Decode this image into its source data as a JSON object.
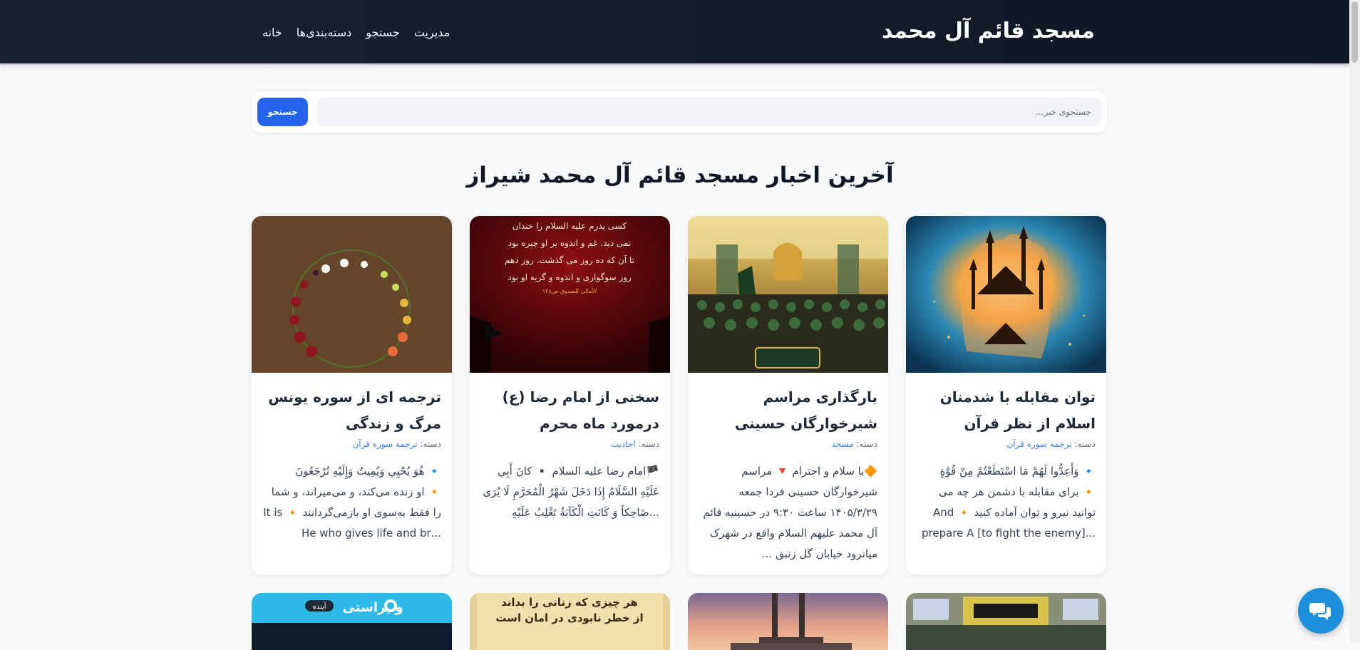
{
  "navbar": {
    "brand": "مسجد قائم آل محمد",
    "links": [
      "خانه",
      "دسته‌بندی‌ها",
      "جستجو",
      "مدیریت"
    ]
  },
  "search": {
    "placeholder": "جستجوی خبر...",
    "button_label": "جستجو"
  },
  "page_title": "آخرین اخبار مسجد قائم آل محمد شیراز",
  "category_prefix": "دسته:",
  "cards": [
    {
      "title": "توان مقابله با شدمنان اسلام از نظر قرآن",
      "category": "ترجمه سوره قرآن",
      "excerpt": [
        "🔹 وَأَعِدُّوا لَهُمْ مَا اسْتَطَعْتُمْ مِنْ قُوَّةٍ",
        "🔸 برای مقابله با دشمن هر چه می",
        "توانید نیرو و توان آماده کنید 🔸 And",
        "...[to fight the enemy] prepare A"
      ],
      "image": "fist-missiles-image"
    },
    {
      "title": "بارگذاری مراسم شیرخوارگان حسینی",
      "category": "مسجد",
      "excerpt": [
        "🔶با سلام و احترام 🔻 مراسم",
        "شیرخوارگان حسینی فردا جمعه",
        "۱۴۰۵/۳/۲۹ ساعت ۹:۳۰ در حسینیه قائم",
        "آل محمد علیهم السلام واقع در شهرک",
        "میانرود خیابان گل زنبق ..."
      ],
      "image": "ceremony-poster-image"
    },
    {
      "title": "سخنی از امام رضا (ع) درمورد ماه محرم",
      "category": "احادیث",
      "excerpt": [
        "🏴امام رضا علیه السلام ▪️ كانَ أَبِي",
        "عَلَيْهِ السَّلَامُ إِذَا دَخَلَ شَهْرُ الْمُحَرَّمِ لَا يُرَى",
        "...ضَاحِكاً وَ كَانَتِ الْكَآبَةُ تَغْلِبُ عَلَيْهِ"
      ],
      "image": "muharram-hadith-image",
      "image_text": [
        "کسی پدرم علیه السلام را خندان",
        "نمی دید. غم و اندوه بر او چیره بود",
        "تا آن که ده روز می گذشت. روز دهم",
        "روز سوگواری و اندوه و گریه او بود",
        "الأمالی للصدوق ص۱۲۸"
      ]
    },
    {
      "title": "ترجمه ای از سوره یونس مرگ و زندگی",
      "category": "ترجمه سوره قرآن",
      "excerpt": [
        "🔹 هُوَ يُحْيِي وَيُمِيتُ وَإِلَيْهِ تُرْجَعُونَ",
        "🔸 او زنده می‌کند، و می‌میراند، و شما",
        "را فقط به‌سوی او بازمی‌گردانند 🔸 It is",
        "...He who gives life and br"
      ],
      "image": "fruit-circle-image"
    }
  ],
  "row2_cards": [
    {
      "image": "vira-banner-image",
      "text": "و یراستی",
      "badge": "آینده"
    },
    {
      "image": "parchment-hadith-image",
      "text": [
        "هر چیزی که زنانی را بداند",
        "از خطر نابودی در امان است"
      ]
    },
    {
      "image": "mosque-sunset-image"
    },
    {
      "image": "shrine-crowd-image"
    }
  ],
  "colors": {
    "navbar": "#131b2a",
    "accent": "#2563eb",
    "category_link": "#3b82f6",
    "chat_fab": "#1d8fdb"
  },
  "chat_button": {
    "icon": "chat-bubbles-icon"
  }
}
